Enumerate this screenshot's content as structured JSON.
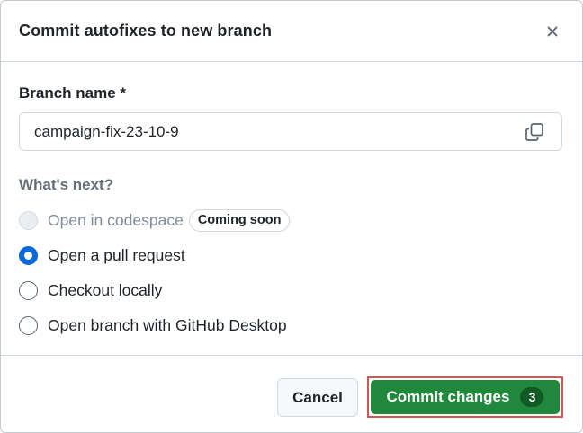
{
  "dialog": {
    "title": "Commit autofixes to new branch",
    "close_icon": "close-icon"
  },
  "branch": {
    "label": "Branch name *",
    "value": "campaign-fix-23-10-9",
    "copy_icon": "copy-icon"
  },
  "next": {
    "label": "What's next?",
    "options": [
      {
        "label": "Open in codespace",
        "badge": "Coming soon",
        "state": "disabled"
      },
      {
        "label": "Open a pull request",
        "state": "selected"
      },
      {
        "label": "Checkout locally",
        "state": "unselected"
      },
      {
        "label": "Open branch with GitHub Desktop",
        "state": "unselected"
      }
    ]
  },
  "footer": {
    "cancel_label": "Cancel",
    "commit_label": "Commit changes",
    "commit_count": "3"
  },
  "colors": {
    "primary_green": "#1f883d",
    "counter_green": "#115a24",
    "radio_blue": "#0969da",
    "highlight_red": "#d9534f"
  }
}
